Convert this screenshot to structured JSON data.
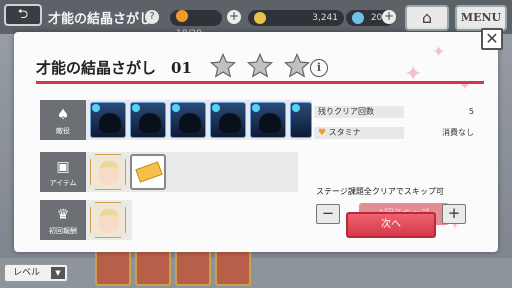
{
  "topbar": {
    "title": "才能の結晶さがし",
    "stamina": "18/20",
    "coins": "3,241",
    "gems": "200",
    "menu_label": "MENU"
  },
  "dialog": {
    "title": "才能の結晶さがし　01",
    "rows": [
      {
        "label": "敵役"
      },
      {
        "label": "アイテム"
      },
      {
        "label": "初回報酬"
      }
    ],
    "info": {
      "remaining_clear_label": "残りクリア回数",
      "remaining_clear_value": "5",
      "stamina_label": "スタミナ",
      "stamina_value": "消費なし"
    },
    "skip_note": "ステージ課題全クリアでスキップ可",
    "skip_button": "1回スキップ",
    "next_button": "次へ"
  },
  "bottom": {
    "level_label": "レベル"
  },
  "colors": {
    "accent_red": "#d8374a",
    "next_button": "#e14b5a",
    "skip_disabled": "#e28c94"
  }
}
